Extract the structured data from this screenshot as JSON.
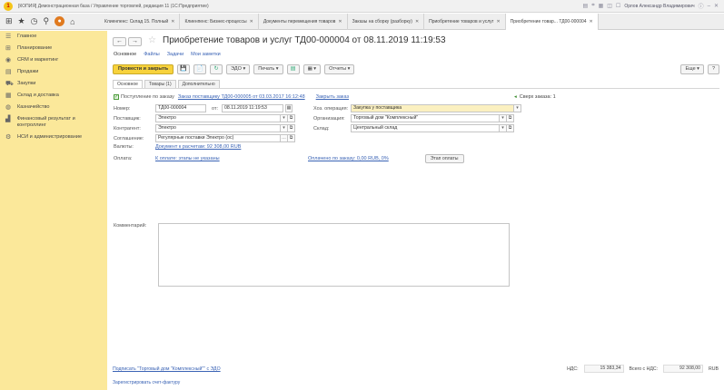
{
  "window": {
    "title": "[КОПИЯ] Демонстрационная база / Управление торговлей, редакция 11 (1С:Предприятие)",
    "user": "Орлов Александр Владимирович"
  },
  "tabs": [
    {
      "label": "Клиенпенс: Склад 15. Полный",
      "active": false
    },
    {
      "label": "Клиенпенс: Бизнес-процессы",
      "active": false
    },
    {
      "label": "Документы перемещения товаров",
      "active": false
    },
    {
      "label": "Заказы на сборку (разборку)",
      "active": false
    },
    {
      "label": "Приобретение товаров и услуг",
      "active": false
    },
    {
      "label": "Приобретение товар... ТД00-000004",
      "active": true
    }
  ],
  "sidebar": {
    "items": [
      {
        "icon": "☰",
        "label": "Главное"
      },
      {
        "icon": "⊞",
        "label": "Планирование"
      },
      {
        "icon": "◉",
        "label": "CRM и маркетинг"
      },
      {
        "icon": "▤",
        "label": "Продажи"
      },
      {
        "icon": "⛟",
        "label": "Закупки"
      },
      {
        "icon": "▦",
        "label": "Склад и доставка"
      },
      {
        "icon": "◍",
        "label": "Казначейство"
      },
      {
        "icon": "▟",
        "label": "Финансовый результат и контроллинг"
      },
      {
        "icon": "⚙",
        "label": "НСИ и администрирование"
      }
    ]
  },
  "document": {
    "title": "Приобретение товаров и услуг ТД00-000004 от 08.11.2019 11:19:53",
    "nav_links": [
      "Основное",
      "Файлы",
      "Задачи",
      "Мои заметки"
    ],
    "commands": {
      "post_close": "Провести и закрыть",
      "save_icon": "💾",
      "edo_icon": "📄",
      "refresh_icon": "↻",
      "edo": "ЭДО",
      "print": "Печать",
      "reports": "Отчеты",
      "more": "Еще",
      "help": "?"
    },
    "subtabs": [
      "Основное",
      "Товары (1)",
      "Дополнительно"
    ],
    "received_checkbox": "Поступление по заказу",
    "order_link": "Заказ поставщику ТД00-000005 от 03.03.2017 16:12:48",
    "close_order_link": "Закрыть заказ",
    "over_order": "Сверх заказа: 1",
    "fields": {
      "number_label": "Номер:",
      "number_value": "ТД00-000004",
      "date_label": "от:",
      "date_value": "08.11.2019 11:19:53",
      "operation_label": "Хоз. операция:",
      "operation_value": "Закупка у поставщика",
      "supplier_label": "Поставщик:",
      "supplier_value": "Электро",
      "organization_label": "Организация:",
      "organization_value": "Торговый дом \"Комплексный\"",
      "counterparty_label": "Контрагент:",
      "counterparty_value": "Электро",
      "warehouse_label": "Склад:",
      "warehouse_value": "Центральный склад",
      "agreement_label": "Соглашение:",
      "agreement_value": "Регулярные поставки Электро (ос)",
      "payments_label": "Валюты:",
      "payments_link": "Документ к расчетам: 92 308,00 RUB",
      "payment_label": "Оплата:",
      "payment_link": "К оплате: этапы не указаны",
      "debt_link": "Оплачено по заказу: 0,00 RUB, 0%",
      "stages_button": "Этап оплаты",
      "comment_label": "Комментарий:"
    },
    "footer": {
      "signature_link": "Подписать \"Торговый дом \"Комплексный\"\" с ЭДО",
      "vat_label": "НДС:",
      "vat_value": "15 383,34",
      "total_label": "Всего с НДС:",
      "total_value": "92 308,00",
      "currency": "RUB",
      "bottom_link": "Зарегистрировать счет-фактуру"
    }
  }
}
